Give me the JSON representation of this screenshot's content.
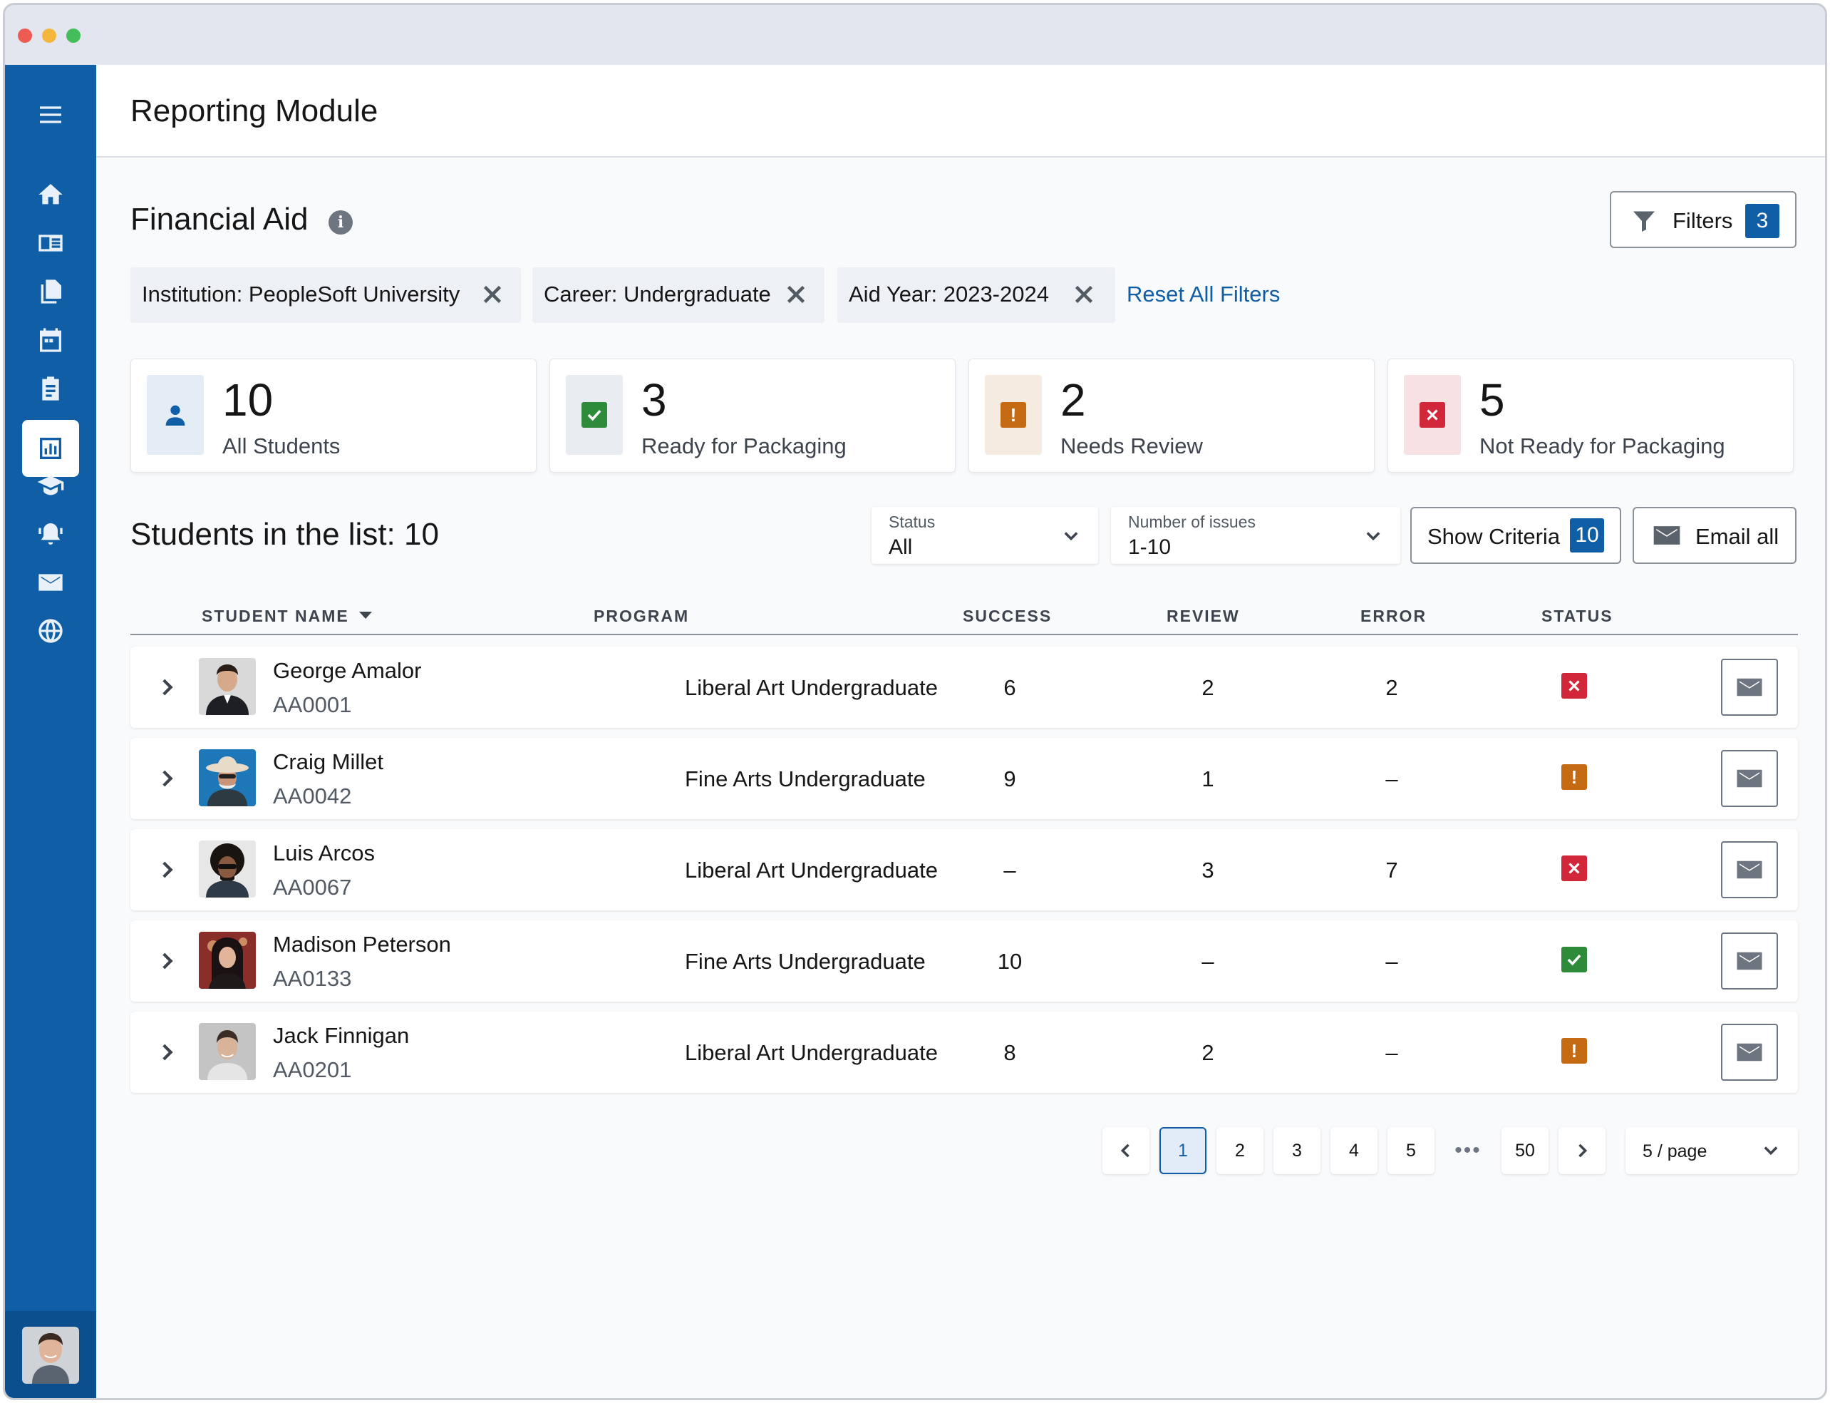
{
  "header": {
    "title": "Reporting Module"
  },
  "section": {
    "title": "Financial Aid"
  },
  "filters_button": {
    "label": "Filters",
    "count": "3"
  },
  "chips": [
    {
      "label": "Institution: PeopleSoft University"
    },
    {
      "label": "Career: Undergraduate"
    },
    {
      "label": "Aid Year: 2023-2024"
    }
  ],
  "reset_label": "Reset All Filters",
  "summary": [
    {
      "value": "10",
      "label": "All Students",
      "icon": "person-icon"
    },
    {
      "value": "3",
      "label": "Ready for Packaging",
      "icon": "check-icon"
    },
    {
      "value": "2",
      "label": "Needs Review",
      "icon": "warning-icon"
    },
    {
      "value": "5",
      "label": "Not Ready for Packaging",
      "icon": "error-icon"
    }
  ],
  "list": {
    "title": "Students in the list: 10",
    "status_filter": {
      "caption": "Status",
      "value": "All"
    },
    "issues_filter": {
      "caption": "Number of issues",
      "value": "1-10"
    },
    "show_criteria": {
      "label": "Show Criteria",
      "count": "10"
    },
    "email_all": {
      "label": "Email all"
    }
  },
  "table": {
    "headers": [
      "STUDENT NAME",
      "PROGRAM",
      "SUCCESS",
      "REVIEW",
      "ERROR",
      "STATUS"
    ],
    "rows": [
      {
        "name": "George Amalor",
        "id": "AA0001",
        "program": "Liberal Art Undergraduate",
        "success": "6",
        "review": "2",
        "error": "2",
        "status": "error"
      },
      {
        "name": "Craig Millet",
        "id": "AA0042",
        "program": "Fine Arts Undergraduate",
        "success": "9",
        "review": "1",
        "error": "–",
        "status": "warning"
      },
      {
        "name": "Luis Arcos",
        "id": "AA0067",
        "program": "Liberal Art Undergraduate",
        "success": "–",
        "review": "3",
        "error": "7",
        "status": "error"
      },
      {
        "name": "Madison Peterson",
        "id": "AA0133",
        "program": "Fine Arts Undergraduate",
        "success": "10",
        "review": "–",
        "error": "–",
        "status": "ok"
      },
      {
        "name": "Jack Finnigan",
        "id": "AA0201",
        "program": "Liberal Art Undergraduate",
        "success": "8",
        "review": "2",
        "error": "–",
        "status": "warning"
      }
    ]
  },
  "pagination": {
    "pages": [
      "1",
      "2",
      "3",
      "4",
      "5",
      "•••",
      "50"
    ],
    "current": "1",
    "per_page": "5 / page"
  },
  "colors": {
    "brand": "#0f5ea6",
    "ok": "#2e8b3a",
    "warning": "#c46a12",
    "error": "#d2263a"
  }
}
